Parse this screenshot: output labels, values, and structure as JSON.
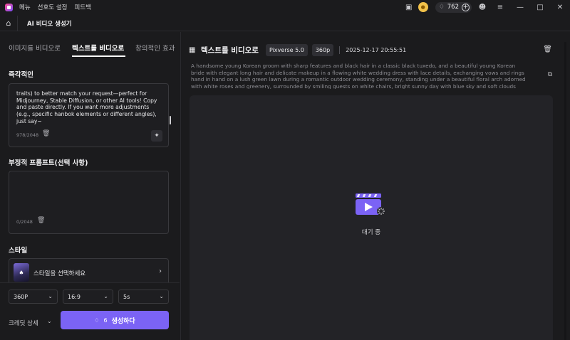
{
  "titlebar": {
    "menu": [
      "메뉴",
      "선호도 설정",
      "피드백"
    ],
    "credits": "762"
  },
  "header": {
    "title": "AI 비디오 생성기"
  },
  "tabs": [
    {
      "label": "이미지를 비디오로"
    },
    {
      "label": "텍스트를 비디오로"
    },
    {
      "label": "창의적인 효과"
    }
  ],
  "prompt_section": {
    "label": "즉각적인",
    "text": "traits) to better match your request—perfect for Midjourney, Stable Diffusion, or other AI tools! Copy and paste directly. If you want more adjustments (e.g., specific hanbok elements or different angles), just say~",
    "counter": "978/2048"
  },
  "negative_section": {
    "label": "부정적 프롬프트(선택 사항)",
    "counter": "0/2048"
  },
  "style_section": {
    "label": "스타일",
    "placeholder": "스타일을 선택하세요"
  },
  "settings": {
    "resolution": "360P",
    "aspect": "16:9",
    "duration": "5s",
    "credit_detail": "크레딧 상세",
    "generate_cost": "6",
    "generate_label": "생성하다"
  },
  "task": {
    "title": "텍스트를 비디오로",
    "model": "Pixverse 5.0",
    "resolution": "360p",
    "timestamp": "2025-12-17 20:55:51",
    "prompt": "A handsome young Korean groom with sharp features and black hair in a classic black tuxedo, and a beautiful young Korean bride with elegant long hair and delicate makeup in a flowing white wedding dress with lace details, exchanging vows and rings hand in hand on a lush green lawn during a romantic outdoor wedding ceremony, standing under a beautiful floral arch adorned with white roses and greenery, surrounded by smiling guests on white chairs, bright sunny day with blue sky and soft clouds",
    "status": "대기 중"
  },
  "colors": {
    "accent": "#7b63f5",
    "background": "#1b1b1d",
    "panel": "#232327"
  }
}
